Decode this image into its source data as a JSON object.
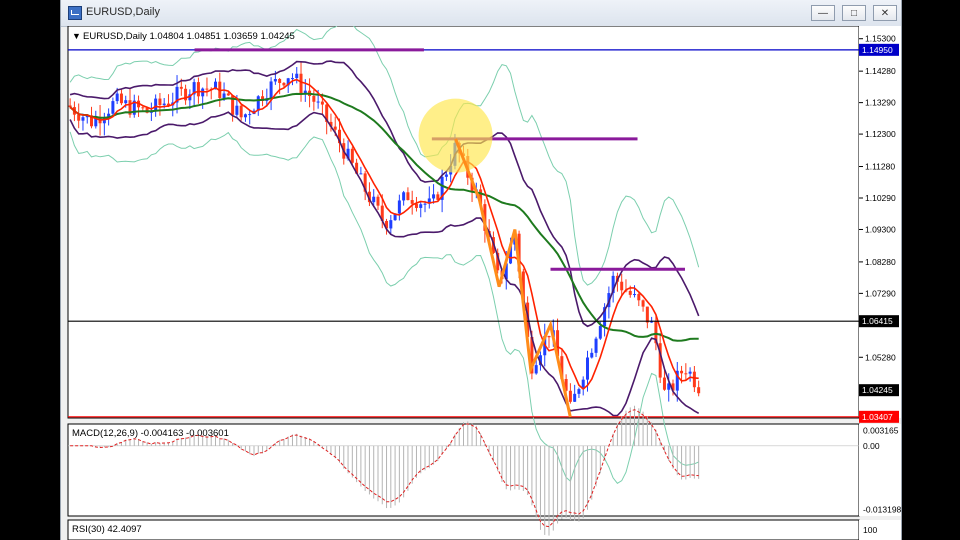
{
  "window": {
    "title": "EURUSD,Daily",
    "minimize_glyph": "—",
    "maximize_glyph": "□",
    "close_glyph": "✕"
  },
  "chart": {
    "header": "EURUSD,Daily  1.04804 1.04851 1.03659 1.04245",
    "indicator_labels": {
      "macd": "MACD(12,26,9) -0.004163 -0.003601",
      "rsi": "RSI(30) 42.4097"
    },
    "colors": {
      "bull_candle": "#1f3fff",
      "bear_candle": "#ff3a1a",
      "ma_long": "#1e7a1e",
      "ema": "#ff2200",
      "bollinger_inner": "#4b1a6b",
      "bollinger_outer": "#7ccfae",
      "annotation": "#8a1a9b",
      "zigzag": "#ff8c1a",
      "highlight": "#ffe64a",
      "blue_level": "#0000c8",
      "red_level": "#ff0000"
    }
  },
  "chart_data": {
    "type": "candlestick",
    "symbol": "EURUSD",
    "timeframe": "Daily",
    "ohlc_last": {
      "open": 1.04804,
      "high": 1.04851,
      "low": 1.03659,
      "close": 1.04245
    },
    "price_axis_ticks": [
      1.153,
      1.1428,
      1.1329,
      1.123,
      1.1128,
      1.1029,
      1.093,
      1.0828,
      1.0729,
      1.0528
    ],
    "ylim": [
      1.0337,
      1.157
    ],
    "tick_labels": [
      "1.15300",
      "1.14280",
      "1.13290",
      "1.12300",
      "1.11280",
      "1.10290",
      "1.09300",
      "1.08280",
      "1.07290",
      "1.05280"
    ],
    "price_tags": [
      {
        "value": 1.1495,
        "label": "1.14950",
        "kind": "blue-level"
      },
      {
        "value": 1.06415,
        "label": "1.06415",
        "kind": "black-level"
      },
      {
        "value": 1.04245,
        "label": "1.04245",
        "kind": "current-price"
      },
      {
        "value": 1.03407,
        "label": "1.03407",
        "kind": "red-level"
      }
    ],
    "annotations": [
      {
        "type": "horizontal-segment",
        "price": 1.1495,
        "x_from": 0.16,
        "x_to": 0.45
      },
      {
        "type": "horizontal-segment",
        "price": 1.1215,
        "x_from": 0.46,
        "x_to": 0.72
      },
      {
        "type": "horizontal-segment",
        "price": 1.0805,
        "x_from": 0.61,
        "x_to": 0.78
      },
      {
        "type": "circle",
        "price": 1.1225,
        "x": 0.49
      }
    ],
    "zigzag": [
      [
        0.49,
        1.1215
      ],
      [
        0.52,
        1.1025
      ],
      [
        0.545,
        1.075
      ],
      [
        0.565,
        1.093
      ],
      [
        0.585,
        1.049
      ],
      [
        0.61,
        1.063
      ],
      [
        0.635,
        1.034
      ]
    ],
    "macd_axis": {
      "ticks": [
        0.003165,
        0.0,
        -0.013198
      ],
      "labels": [
        "0.003165",
        "0.00",
        "-0.013198"
      ],
      "ylim": [
        -0.0145,
        0.0045
      ]
    },
    "rsi_axis": {
      "ticks": [
        100
      ],
      "labels": [
        "100"
      ]
    }
  }
}
